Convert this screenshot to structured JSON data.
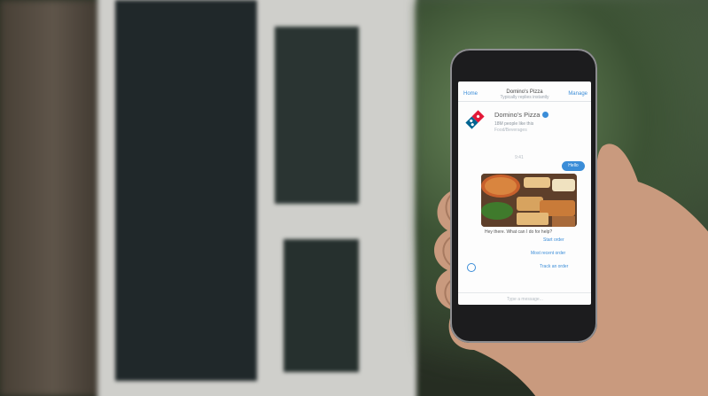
{
  "scene": {
    "description_colors": {
      "accent_blue": "#3b8dd8",
      "dominos_red": "#e31837",
      "dominos_blue": "#006491"
    }
  },
  "phone": {
    "header": {
      "back_label": "Home",
      "title": "Domino's Pizza",
      "subtitle": "Typically replies instantly",
      "manage_label": "Manage"
    },
    "business": {
      "name": "Domino's Pizza",
      "line1": "18M people like this",
      "line2": "Food/Beverages"
    },
    "timestamp": "9:41",
    "user_bubble": "Hello",
    "bot_question": "Hey there. What can I do for help?",
    "quick_replies": [
      "Start order",
      "Most recent order",
      "Track an order"
    ],
    "composer_placeholder": "Type a message..."
  }
}
